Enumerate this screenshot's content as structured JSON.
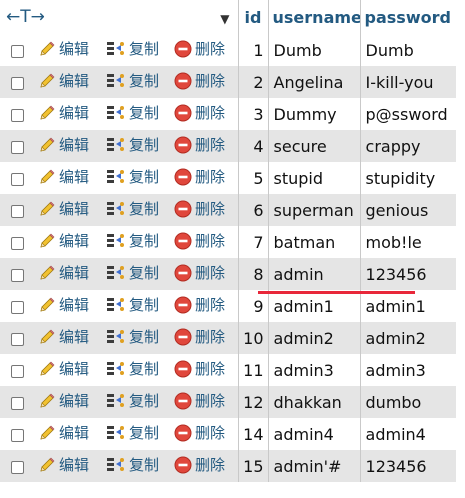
{
  "header": {
    "arrows": "←T→",
    "dropdown": "▼",
    "columns": [
      "id",
      "username",
      "password"
    ]
  },
  "actions": {
    "edit": "编辑",
    "copy": "复制",
    "delete": "删除"
  },
  "colors": {
    "link": "#235a81",
    "row_alt": "#e5e5e5",
    "annotation": "#e8273a"
  },
  "rows": [
    {
      "id": "1",
      "username": "Dumb",
      "password": "Dumb"
    },
    {
      "id": "2",
      "username": "Angelina",
      "password": "I-kill-you"
    },
    {
      "id": "3",
      "username": "Dummy",
      "password": "p@ssword"
    },
    {
      "id": "4",
      "username": "secure",
      "password": "crappy"
    },
    {
      "id": "5",
      "username": "stupid",
      "password": "stupidity"
    },
    {
      "id": "6",
      "username": "superman",
      "password": "genious"
    },
    {
      "id": "7",
      "username": "batman",
      "password": "mob!le"
    },
    {
      "id": "8",
      "username": "admin",
      "password": "123456"
    },
    {
      "id": "9",
      "username": "admin1",
      "password": "admin1"
    },
    {
      "id": "10",
      "username": "admin2",
      "password": "admin2"
    },
    {
      "id": "11",
      "username": "admin3",
      "password": "admin3"
    },
    {
      "id": "12",
      "username": "dhakkan",
      "password": "dumbo"
    },
    {
      "id": "14",
      "username": "admin4",
      "password": "admin4"
    },
    {
      "id": "15",
      "username": "admin'#",
      "password": "123456"
    }
  ]
}
